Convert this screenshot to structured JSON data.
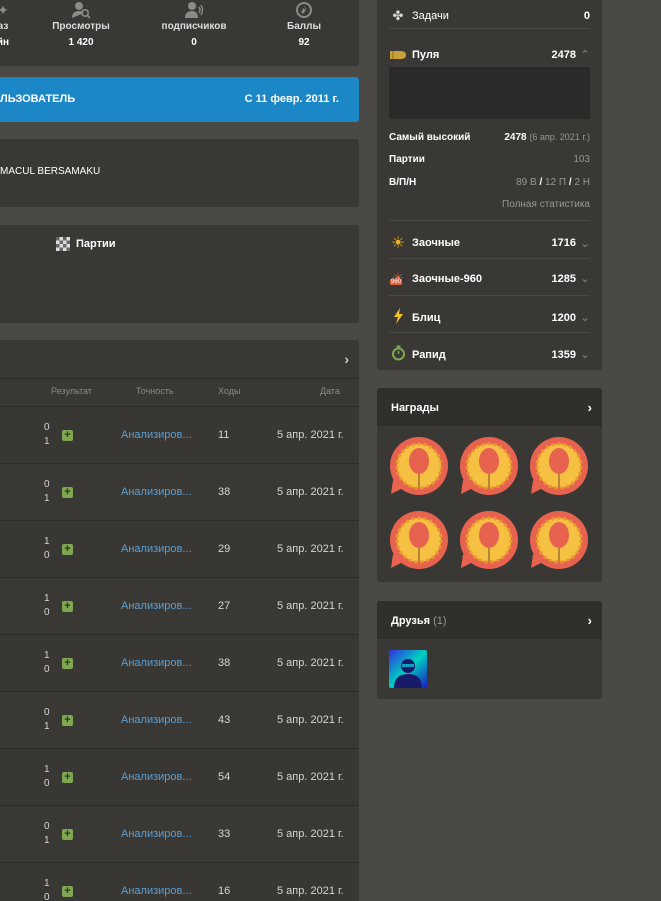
{
  "stats": [
    {
      "label": "аз",
      "value": "йн",
      "icon": "puzzle-icon"
    },
    {
      "label": "Просмотры",
      "value": "1 420",
      "icon": "views-icon"
    },
    {
      "label": "подписчиков",
      "value": "0",
      "icon": "followers-icon"
    },
    {
      "label": "Баллы",
      "value": "92",
      "icon": "points-icon"
    }
  ],
  "member": {
    "label": "ЛЬЗОВАТЕЛЬ",
    "since": "С 11 февр. 2011 г."
  },
  "profile": {
    "name": "MACUL BERSAMAKU"
  },
  "tabs": {
    "games": "Партии"
  },
  "games_table": {
    "headers": {
      "result": "Результат",
      "accuracy": "Точность",
      "moves": "Ходы",
      "date": "Дата"
    },
    "rows": [
      {
        "r1": "0",
        "r2": "1",
        "accuracy": "Анализиров...",
        "moves": "11",
        "date": "5 апр. 2021 г."
      },
      {
        "r1": "0",
        "r2": "1",
        "accuracy": "Анализиров...",
        "moves": "38",
        "date": "5 апр. 2021 г."
      },
      {
        "r1": "1",
        "r2": "0",
        "accuracy": "Анализиров...",
        "moves": "29",
        "date": "5 апр. 2021 г."
      },
      {
        "r1": "1",
        "r2": "0",
        "accuracy": "Анализиров...",
        "moves": "27",
        "date": "5 апр. 2021 г."
      },
      {
        "r1": "1",
        "r2": "0",
        "accuracy": "Анализиров...",
        "moves": "38",
        "date": "5 апр. 2021 г."
      },
      {
        "r1": "0",
        "r2": "1",
        "accuracy": "Анализиров...",
        "moves": "43",
        "date": "5 апр. 2021 г."
      },
      {
        "r1": "1",
        "r2": "0",
        "accuracy": "Анализиров...",
        "moves": "54",
        "date": "5 апр. 2021 г."
      },
      {
        "r1": "0",
        "r2": "1",
        "accuracy": "Анализиров...",
        "moves": "33",
        "date": "5 апр. 2021 г."
      },
      {
        "r1": "1",
        "r2": "0",
        "accuracy": "Анализиров...",
        "moves": "16",
        "date": "5 апр. 2021 г."
      }
    ]
  },
  "ratings": {
    "puzzles": {
      "label": "Задачи",
      "value": "0"
    },
    "bullet": {
      "label": "Пуля",
      "value": "2478"
    },
    "highest": {
      "label": "Самый высокий",
      "value": "2478",
      "date": "(6 апр. 2021 г.)"
    },
    "games": {
      "label": "Партии",
      "value": "103"
    },
    "wdl": {
      "label": "В/П/Н",
      "w": "89 В",
      "l": "12 П",
      "d": "2 Н",
      "sep": "/"
    },
    "full_stats": "Полная статистика",
    "items": [
      {
        "label": "Заочные",
        "value": "1716"
      },
      {
        "label": "Заочные-960",
        "value": "1285"
      },
      {
        "label": "Блиц",
        "value": "1200"
      },
      {
        "label": "Рапид",
        "value": "1359"
      }
    ],
    "icon960": "960"
  },
  "awards": {
    "title": "Награды"
  },
  "friends": {
    "title": "Друзья",
    "count": "(1)"
  },
  "colors": {
    "accent_blue": "#1b87c6",
    "link": "#5b9fd3",
    "win_green": "#7fa650",
    "bullet": "#c8a13a"
  }
}
